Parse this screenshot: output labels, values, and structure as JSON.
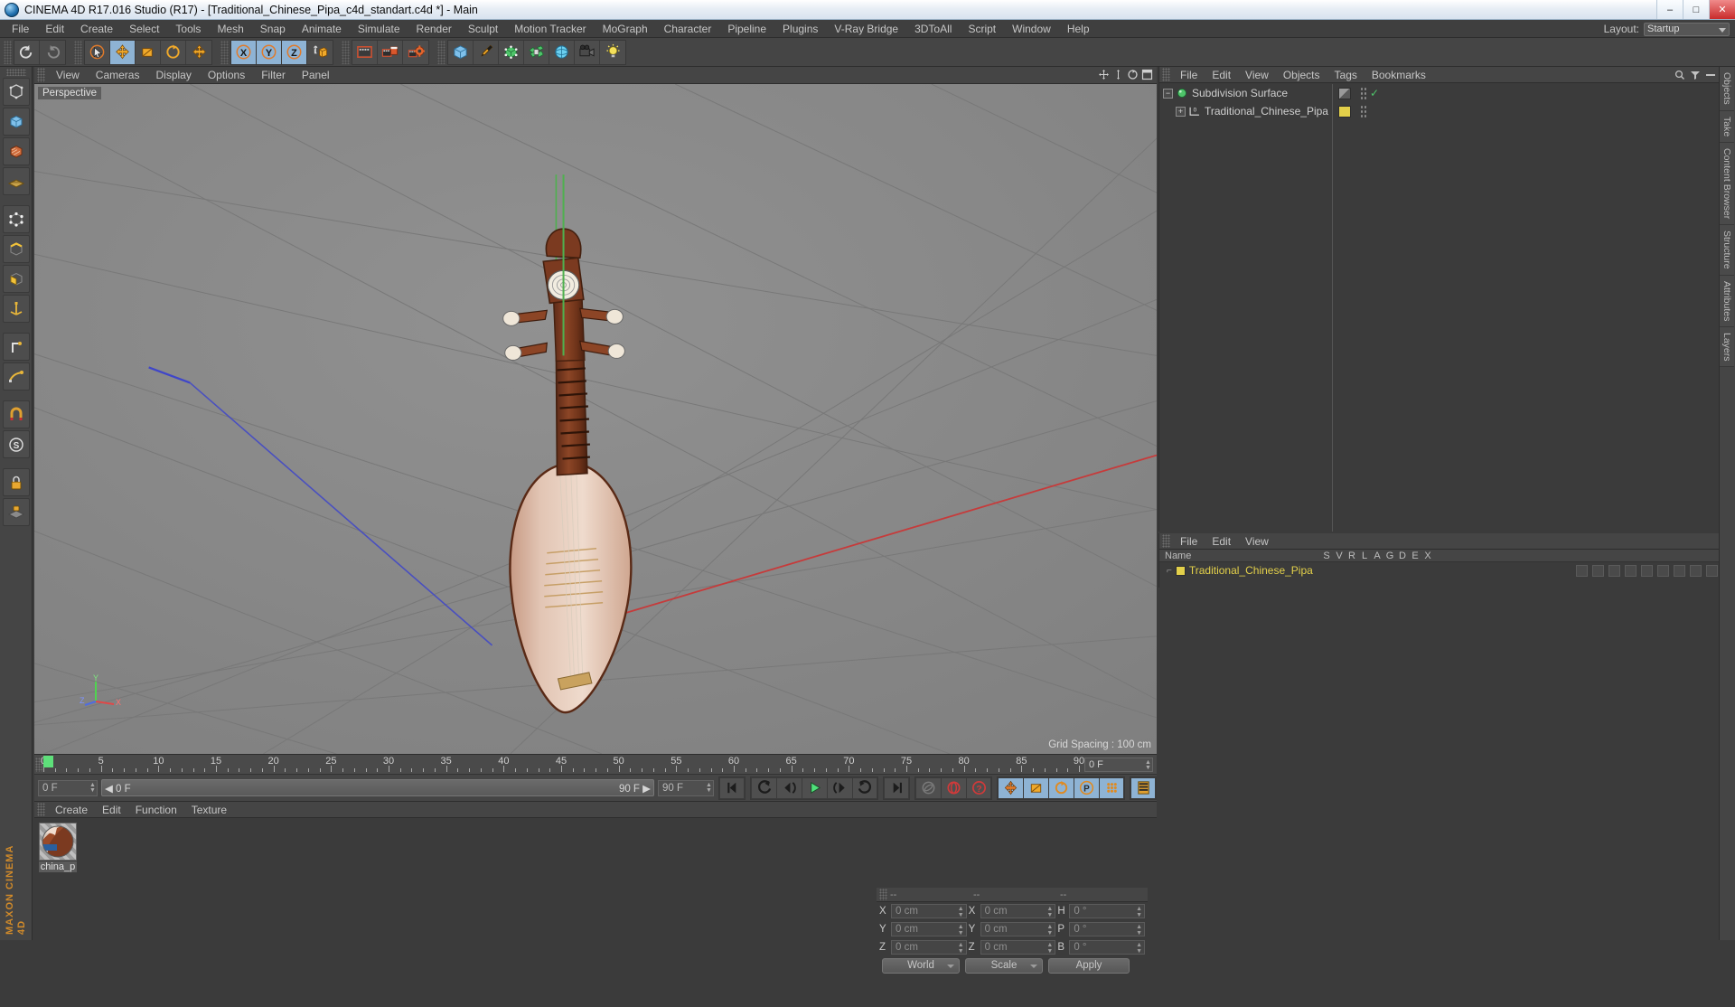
{
  "window": {
    "title": "CINEMA 4D R17.016 Studio (R17) - [Traditional_Chinese_Pipa_c4d_standart.c4d *] - Main",
    "minimize": "–",
    "maximize": "□",
    "close": "✕"
  },
  "menubar": {
    "items": [
      "File",
      "Edit",
      "Create",
      "Select",
      "Tools",
      "Mesh",
      "Snap",
      "Animate",
      "Simulate",
      "Render",
      "Sculpt",
      "Motion Tracker",
      "MoGraph",
      "Character",
      "Pipeline",
      "Plugins",
      "V-Ray Bridge",
      "3DToAll",
      "Script",
      "Window",
      "Help"
    ],
    "layout_label": "Layout:",
    "layout_value": "Startup"
  },
  "toolbar": {
    "groups": [
      {
        "name": "undo-redo",
        "buttons": [
          {
            "name": "undo-button",
            "icon": "undo-icon",
            "state": "normal"
          },
          {
            "name": "redo-button",
            "icon": "redo-icon",
            "state": "disabled"
          }
        ]
      },
      {
        "name": "transform-tools",
        "buttons": [
          {
            "name": "live-selection-tool",
            "icon": "cursor-icon",
            "state": "normal"
          },
          {
            "name": "move-tool",
            "icon": "move-icon",
            "state": "selected"
          },
          {
            "name": "scale-tool",
            "icon": "scale-icon",
            "state": "normal"
          },
          {
            "name": "rotate-tool",
            "icon": "rotate-icon",
            "state": "normal"
          },
          {
            "name": "move-axis-tool",
            "icon": "move-axis-icon",
            "state": "normal"
          }
        ]
      },
      {
        "name": "axis-locks",
        "buttons": [
          {
            "name": "x-axis-lock",
            "icon": "x-icon",
            "state": "selected"
          },
          {
            "name": "y-axis-lock",
            "icon": "y-icon",
            "state": "selected"
          },
          {
            "name": "z-axis-lock",
            "icon": "z-icon",
            "state": "selected"
          },
          {
            "name": "world-coordinate-toggle",
            "icon": "world-box-icon",
            "state": "normal"
          }
        ]
      },
      {
        "name": "render-tools",
        "buttons": [
          {
            "name": "render-view-button",
            "icon": "render-view-icon",
            "state": "normal"
          },
          {
            "name": "render-to-picture-viewer-button",
            "icon": "render-picture-icon",
            "state": "normal"
          },
          {
            "name": "render-settings-button",
            "icon": "render-settings-icon",
            "state": "normal"
          }
        ]
      },
      {
        "name": "create-objects",
        "buttons": [
          {
            "name": "add-cube-button",
            "icon": "cube-icon",
            "state": "normal"
          },
          {
            "name": "add-spline-button",
            "icon": "pen-icon",
            "state": "normal"
          },
          {
            "name": "add-generator-button",
            "icon": "subdivision-surface-icon",
            "state": "normal"
          },
          {
            "name": "add-deformer-button",
            "icon": "deformer-icon",
            "state": "normal"
          },
          {
            "name": "add-environment-button",
            "icon": "environment-icon",
            "state": "normal"
          },
          {
            "name": "add-camera-button",
            "icon": "camera-icon",
            "state": "normal"
          },
          {
            "name": "add-light-button",
            "icon": "light-icon",
            "state": "normal"
          }
        ]
      }
    ]
  },
  "left_palette": {
    "buttons": [
      {
        "name": "mode-editable-tool",
        "icon": "make-editable-icon"
      },
      {
        "name": "mode-model-tool",
        "icon": "model-mode-icon"
      },
      {
        "name": "mode-texture-tool",
        "icon": "texture-mode-icon"
      },
      {
        "name": "mode-workplane-tool",
        "icon": "workplane-icon"
      },
      {
        "name": "mode-points-tool",
        "icon": "points-mode-icon"
      },
      {
        "name": "mode-edges-tool",
        "icon": "edges-mode-icon"
      },
      {
        "name": "mode-polygons-tool",
        "icon": "polygons-mode-icon"
      },
      {
        "name": "mode-axis-tool",
        "icon": "axis-mode-icon"
      },
      {
        "name": "mode-enable-axis-tool",
        "icon": "enable-axis-icon"
      },
      {
        "name": "mode-object-axis-tool",
        "icon": "object-axis-icon"
      },
      {
        "name": "mode-snap-tool",
        "icon": "magnet-icon"
      },
      {
        "name": "mode-viewport-solo-tool",
        "icon": "viewport-solo-icon"
      },
      {
        "name": "mode-lock-tool",
        "icon": "lock-icon"
      },
      {
        "name": "mode-workplane-lock-tool",
        "icon": "workplane-lock-icon"
      }
    ],
    "brand": "MAXON CINEMA 4D"
  },
  "viewport": {
    "menu": [
      "View",
      "Cameras",
      "Display",
      "Options",
      "Filter",
      "Panel"
    ],
    "label": "Perspective",
    "grid_spacing": "Grid Spacing : 100 cm",
    "axis": {
      "x": "X",
      "y": "Y",
      "z": "Z"
    },
    "icons": [
      {
        "name": "viewport-move-icon"
      },
      {
        "name": "viewport-scale-icon"
      },
      {
        "name": "viewport-rotate-icon"
      },
      {
        "name": "viewport-maximize-icon"
      }
    ]
  },
  "object_manager": {
    "menu": [
      "File",
      "Edit",
      "View",
      "Objects",
      "Tags",
      "Bookmarks"
    ],
    "search_icon": "search-icon",
    "filter_icon": "filter-icon",
    "rows": [
      {
        "name": "Subdivision Surface",
        "icon": "subdivision-surface-icon",
        "indent": 0,
        "expander": "−",
        "layer_color": "#808080",
        "check": "✓"
      },
      {
        "name": "Traditional_Chinese_Pipa",
        "icon": "null-object-icon",
        "indent": 1,
        "expander": "+",
        "layer_color": "#e3d04a",
        "check": ""
      }
    ]
  },
  "attribute_manager": {
    "menu": [
      "File",
      "Edit",
      "View"
    ],
    "columns": [
      "Name",
      "S",
      "V",
      "R",
      "L",
      "A",
      "G",
      "D",
      "E",
      "X"
    ],
    "rows": [
      {
        "name": "Traditional_Chinese_Pipa",
        "color": "#e3d04a"
      }
    ]
  },
  "right_tabs": [
    "Objects",
    "Take",
    "Content Browser",
    "Structure",
    "Attributes",
    "Layers"
  ],
  "timeline": {
    "labels": [
      "0",
      "5",
      "10",
      "15",
      "20",
      "25",
      "30",
      "35",
      "40",
      "45",
      "50",
      "55",
      "60",
      "65",
      "70",
      "75",
      "80",
      "85",
      "90"
    ],
    "start": 0,
    "end": 90,
    "current_frame_box": "0 F"
  },
  "playback": {
    "current_frame": "0 F",
    "scrub_start": "0 F",
    "scrub_end": "90 F",
    "max_frame": "90 F",
    "buttons": [
      {
        "name": "go-to-start-button",
        "icon": "go-to-start-icon"
      },
      {
        "name": "previous-key-button",
        "icon": "previous-key-icon"
      },
      {
        "name": "step-back-button",
        "icon": "step-back-icon"
      },
      {
        "name": "play-button",
        "icon": "play-icon"
      },
      {
        "name": "step-forward-button",
        "icon": "step-forward-icon"
      },
      {
        "name": "next-key-button",
        "icon": "next-key-icon"
      },
      {
        "name": "go-to-end-button",
        "icon": "go-to-end-icon"
      },
      {
        "name": "record-active-objects-button",
        "icon": "record-key-icon"
      },
      {
        "name": "autokeying-button",
        "icon": "autokey-icon"
      },
      {
        "name": "keyframe-selection-button",
        "icon": "keyframe-select-icon"
      },
      {
        "name": "position-key-button",
        "icon": "position-key-icon"
      },
      {
        "name": "scale-key-button",
        "icon": "scale-key-icon"
      },
      {
        "name": "rotation-key-button",
        "icon": "rotation-key-icon"
      },
      {
        "name": "parameter-key-button",
        "icon": "parameter-key-icon"
      },
      {
        "name": "point-level-animation-button",
        "icon": "pla-icon"
      },
      {
        "name": "timeline-toggle-button",
        "icon": "timeline-icon"
      }
    ]
  },
  "material_manager": {
    "menu": [
      "Create",
      "Edit",
      "Function",
      "Texture"
    ],
    "materials": [
      {
        "name": "china_p",
        "preview": "checker-sphere"
      }
    ]
  },
  "coordinate_manager": {
    "headers": [
      "--",
      "--",
      "--"
    ],
    "position": {
      "label_x": "X",
      "x": "0 cm",
      "label_y": "Y",
      "y": "0 cm",
      "label_z": "Z",
      "z": "0 cm"
    },
    "size": {
      "label_x": "X",
      "x": "0 cm",
      "label_y": "Y",
      "y": "0 cm",
      "label_z": "Z",
      "z": "0 cm"
    },
    "rotation": {
      "label_h": "H",
      "h": "0 °",
      "label_p": "P",
      "p": "0 °",
      "label_b": "B",
      "b": "0 °"
    },
    "coord_system": "World",
    "mode": "Scale",
    "apply_label": "Apply"
  },
  "colors": {
    "accent_blue": "#8eb3d4",
    "orange": "#e08a20",
    "green": "#4fc46a",
    "red": "#cf3030",
    "layer_yellow": "#e3d04a"
  }
}
